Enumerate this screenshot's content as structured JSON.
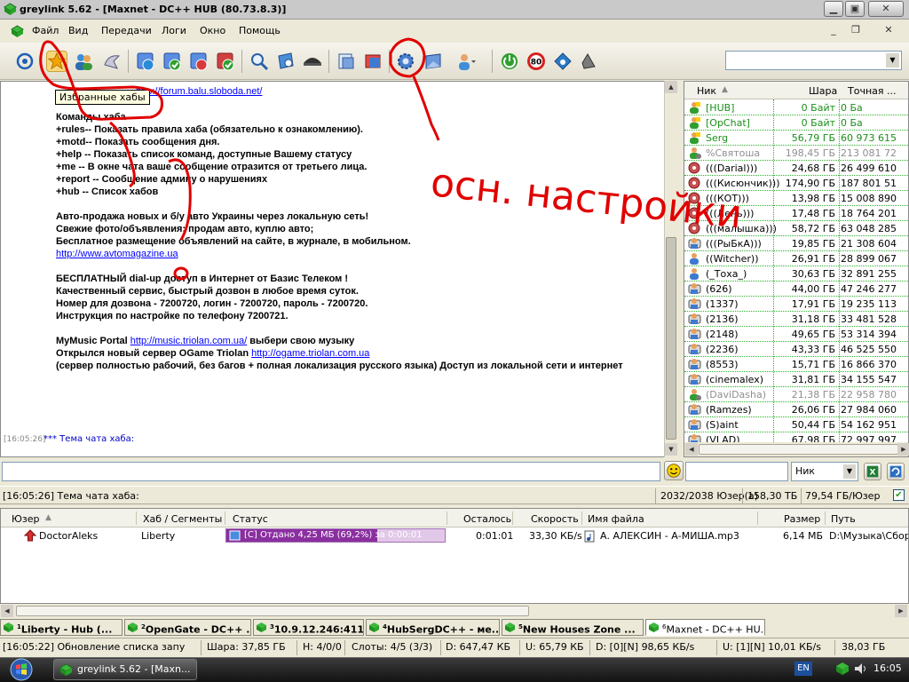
{
  "window": {
    "title": "greylink 5.62 - [Maxnet - DC++ HUB (80.73.8.3)]"
  },
  "menu": [
    "Файл",
    "Вид",
    "Передачи",
    "Логи",
    "Окно",
    "Помощь"
  ],
  "toolbar": {
    "tooltip": "Избранные хабы",
    "icons": [
      "reconnect-icon",
      "favorite-hubs-icon",
      "favorite-users-icon",
      "ignored-users-icon",
      "queue-icon",
      "finished-downloads-icon",
      "waiting-users-icon",
      "finished-uploads-icon",
      "search-icon",
      "adl-search-icon",
      "search-spy-icon",
      "open-file-list-icon",
      "refresh-file-list-icon",
      "settings-icon",
      "network-stats-icon",
      "away-icon",
      "connect-icon",
      "limiter-icon",
      "notepad-icon",
      "sound-icon"
    ],
    "hub_combo_value": ""
  },
  "chat": {
    "lines": [
      {
        "text": "Команды хаба"
      },
      {
        "text": "+rules-- Показать правила хаба (обязательно к ознакомлению)."
      },
      {
        "text": "+motd-- Показать  сообщения дня."
      },
      {
        "text": "+help  -- Показать список команд, доступные Вашему статусу"
      },
      {
        "text": "+me                 -- В окне чата ваше сообщение отразится от третьего лица."
      },
      {
        "text": "+report             -- Сообщение админу о нарушениях"
      },
      {
        "text": "+hub   -- Список хабов"
      },
      {
        "text": ""
      },
      {
        "text": "Авто-продажа новых и б/у авто Украины через локальную сеть!"
      },
      {
        "text": "Свежие фото/объявления: продам авто, куплю авто;"
      },
      {
        "text": "Бесплатное размещение объявлений на сайте, в журнале, в мобильном."
      },
      {
        "text": "",
        "link": "http://www.avtomagazine.ua"
      },
      {
        "text": ""
      },
      {
        "text": "БЕСПЛАТНЫЙ dial-up доступ в Интернет от Базис Телеком !"
      },
      {
        "text": "Качественный сервис, быстрый дозвон в любое время суток."
      },
      {
        "text": "Номер для дозвона - 7200720, логин - 7200720, пароль - 7200720."
      },
      {
        "text": "Инструкция по настройке по телефону 7200721."
      },
      {
        "text": ""
      },
      {
        "text": "MyMusic Portal ",
        "link": "http://music.triolan.com.ua/",
        "after": " выбери свою музыку"
      },
      {
        "text": "Открылся новый сервер OGame Triolan ",
        "link": "http://ogame.triolan.com.ua"
      },
      {
        "text": "(сервер полностью рабочий, без багов + полная локализация русского языка) Доступ из локальной сети и интернет"
      }
    ],
    "top_link": "http://forum.balu.sloboda.net/",
    "topic_time": "[16:05:26]",
    "topic_text": "*** Тема чата хаба:"
  },
  "users": {
    "columns": [
      "Ник",
      "Шара",
      "Точная ..."
    ],
    "rows": [
      {
        "nick": "[HUB]",
        "share": "0 Байт",
        "exact": "0 Ба",
        "color": "#1b8f1b",
        "icon": "op"
      },
      {
        "nick": "[OpChat]",
        "share": "0 Байт",
        "exact": "0 Ба",
        "color": "#1b8f1b",
        "icon": "op"
      },
      {
        "nick": "Serg",
        "share": "56,79 ГБ",
        "exact": "60 973 615",
        "color": "#1b8f1b",
        "icon": "op"
      },
      {
        "nick": "%Святоша",
        "share": "198,45 ГБ",
        "exact": "213 081 72",
        "color": "#8f8f8f",
        "icon": "away"
      },
      {
        "nick": "(((Darial)))",
        "share": "24,68 ГБ",
        "exact": "26 499 610",
        "color": "#000",
        "icon": "passive"
      },
      {
        "nick": "(((Кисюнчик)))",
        "share": "174,90 ГБ",
        "exact": "187 801 51",
        "color": "#000",
        "icon": "passive"
      },
      {
        "nick": "(((КОТ)))",
        "share": "13,98 ГБ",
        "exact": "15 008 890",
        "color": "#000",
        "icon": "passive"
      },
      {
        "nick": "(((Лень)))",
        "share": "17,48 ГБ",
        "exact": "18 764 201",
        "color": "#000",
        "icon": "passive"
      },
      {
        "nick": "(((малышка)))",
        "share": "58,72 ГБ",
        "exact": "63 048 285",
        "color": "#000",
        "icon": "passive"
      },
      {
        "nick": "(((РыБкА)))",
        "share": "19,85 ГБ",
        "exact": "21 308 604",
        "color": "#000",
        "icon": "active"
      },
      {
        "nick": "((Witcher))",
        "share": "26,91 ГБ",
        "exact": "28 899 067",
        "color": "#000",
        "icon": "user"
      },
      {
        "nick": "(_Тоха_)",
        "share": "30,63 ГБ",
        "exact": "32 891 255",
        "color": "#000",
        "icon": "user"
      },
      {
        "nick": "(626)",
        "share": "44,00 ГБ",
        "exact": "47 246 277",
        "color": "#000",
        "icon": "active"
      },
      {
        "nick": "(1337)",
        "share": "17,91 ГБ",
        "exact": "19 235 113",
        "color": "#000",
        "icon": "active"
      },
      {
        "nick": "(2136)",
        "share": "31,18 ГБ",
        "exact": "33 481 528",
        "color": "#000",
        "icon": "active"
      },
      {
        "nick": "(2148)",
        "share": "49,65 ГБ",
        "exact": "53 314 394",
        "color": "#000",
        "icon": "active"
      },
      {
        "nick": "(2236)",
        "share": "43,33 ГБ",
        "exact": "46 525 550",
        "color": "#000",
        "icon": "active"
      },
      {
        "nick": "(8553)",
        "share": "15,71 ГБ",
        "exact": "16 866 370",
        "color": "#000",
        "icon": "active"
      },
      {
        "nick": "(cinemalex)",
        "share": "31,81 ГБ",
        "exact": "34 155 547",
        "color": "#000",
        "icon": "active"
      },
      {
        "nick": "(DaviDasha)",
        "share": "21,38 ГБ",
        "exact": "22 958 780",
        "color": "#8f8f8f",
        "icon": "away"
      },
      {
        "nick": "(Ramzes)",
        "share": "26,06 ГБ",
        "exact": "27 984 060",
        "color": "#000",
        "icon": "active"
      },
      {
        "nick": "(S)aint",
        "share": "50,44 ГБ",
        "exact": "54 162 951",
        "color": "#000",
        "icon": "active"
      },
      {
        "nick": "(VLAD)",
        "share": "67,98 ГБ",
        "exact": "72 997 997",
        "color": "#000",
        "icon": "active"
      }
    ]
  },
  "input": {
    "message_value": "",
    "search_value": "",
    "filter_field": "Ник"
  },
  "status1": {
    "message": "[16:05:26] Тема чата хаба:",
    "users": "2032/2038 Юзер(а)",
    "share": "158,30 ТБ",
    "per_user": "79,54 ГБ/Юзер"
  },
  "transfers": {
    "columns": [
      "Юзер",
      "Хаб / Сегменты",
      "Статус",
      "Осталось",
      "Скорость",
      "Имя файла",
      "Размер",
      "Путь"
    ],
    "rows": [
      {
        "user": "DoctorAleks",
        "hub": "Liberty",
        "status": "[С] Отдано 4,25 МБ (69,2%) за 0:00:01",
        "progress": 0.692,
        "left": "0:01:01",
        "speed": "33,30 КБ/s",
        "file": "А. АЛЕКСИН - А-МИША.mp3",
        "size": "6,14 МБ",
        "path": "D:\\Музыка\\Сборн"
      }
    ]
  },
  "tabs": [
    {
      "num": "1",
      "label": "Liberty - Hub  (...",
      "active": false
    },
    {
      "num": "2",
      "label": "OpenGate - DC++ ...",
      "active": false
    },
    {
      "num": "3",
      "label": "10.9.12.246:411",
      "active": false
    },
    {
      "num": "4",
      "label": "HubSergDC++ - ме...",
      "active": false
    },
    {
      "num": "5",
      "label": "New Houses Zone ...",
      "active": false
    },
    {
      "num": "6",
      "label": "Maxnet - DC++ HU...",
      "active": true
    }
  ],
  "status2": {
    "message": "[16:05:22] Обновление списка запу",
    "share": "Шара: 37,85 ГБ",
    "hubs": "Н: 4/0/0",
    "slots": "Слоты: 4/5 (3/3)",
    "downloaded": "D: 647,47 КБ",
    "uploaded": "U: 65,79 КБ",
    "dl_speed": "D: [0][N] 98,65 КБ/s",
    "ul_speed": "U: [1][N] 10,01 КБ/s",
    "total": "38,03 ГБ"
  },
  "taskbar": {
    "window_button": "greylink 5.62 - [Maxn...",
    "language": "EN",
    "clock": "16:05"
  },
  "annotations": {
    "text": "осн. настройки",
    "color": "#e00000"
  }
}
